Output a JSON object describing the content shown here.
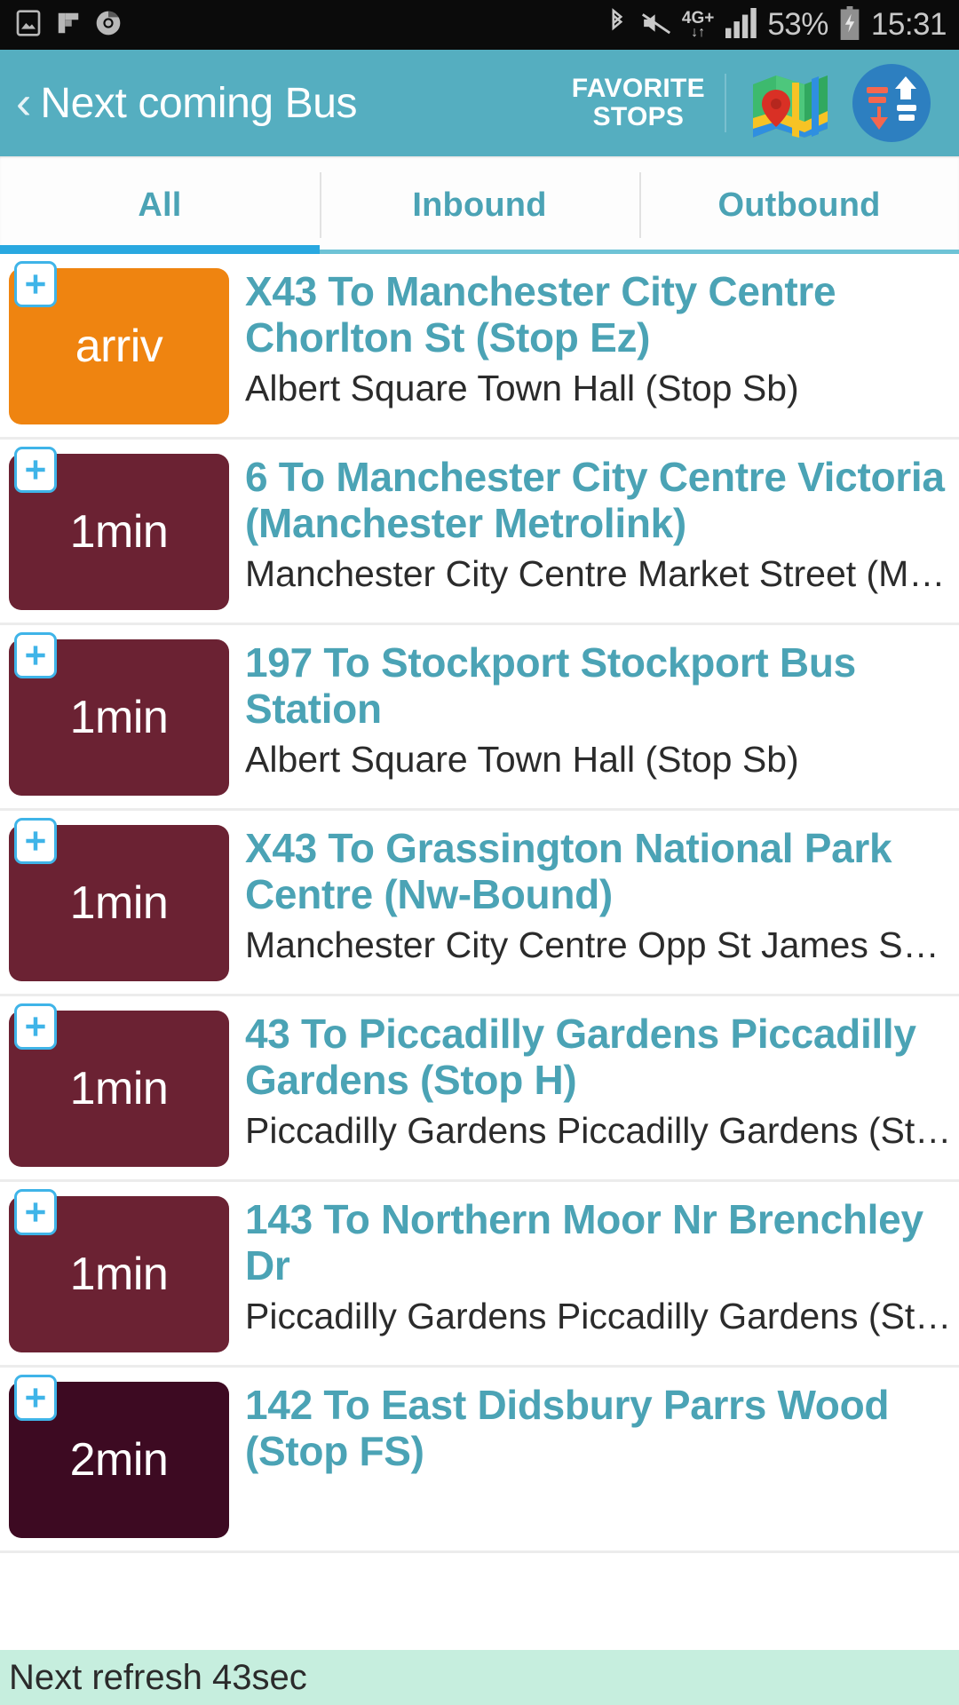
{
  "status_bar": {
    "time": "15:31",
    "battery_percent": "53%",
    "network": "4G+",
    "left_icons": [
      "gallery-icon",
      "flipboard-icon",
      "chrome-icon"
    ],
    "right_icons": [
      "bluetooth-icon",
      "mute-icon",
      "data-transfer-icon",
      "signal-bars-icon",
      "battery-charging-icon"
    ]
  },
  "app_bar": {
    "back_label": "‹",
    "title": "Next coming Bus",
    "favorite_stops_line1": "FAVORITE",
    "favorite_stops_line2": "STOPS",
    "map_icon": "map-icon",
    "sort_icon": "sort-refresh-icon",
    "background_color": "#55aec0"
  },
  "tabs": {
    "active_index": 0,
    "items": [
      {
        "label": "All"
      },
      {
        "label": "Inbound"
      },
      {
        "label": "Outbound"
      }
    ],
    "active_color": "#29a8e0",
    "text_color": "#4ba3b5"
  },
  "list": {
    "rows": [
      {
        "time": "arriv",
        "badge_color": "#ef8410",
        "route": "X43 To Manchester City Centre Chorlton St (Stop Ez)",
        "stop": "Albert Square Town Hall (Stop Sb)",
        "add_icon": "plus-icon"
      },
      {
        "time": "1min",
        "badge_color": "#6b2233",
        "route": "6 To Manchester City Centre Victoria (Manchester Metrolink)",
        "stop": "Manchester City Centre Market Street (M…",
        "add_icon": "plus-icon"
      },
      {
        "time": "1min",
        "badge_color": "#6b2233",
        "route": "197 To Stockport Stockport Bus Station",
        "stop": "Albert Square Town Hall (Stop Sb)",
        "add_icon": "plus-icon"
      },
      {
        "time": "1min",
        "badge_color": "#6b2233",
        "route": "X43 To Grassington National Park Centre (Nw-Bound)",
        "stop": "Manchester City Centre Opp St James Sq…",
        "add_icon": "plus-icon"
      },
      {
        "time": "1min",
        "badge_color": "#6b2233",
        "route": "43 To Piccadilly Gardens Piccadilly Gardens (Stop H)",
        "stop": "Piccadilly Gardens Piccadilly Gardens (St…",
        "add_icon": "plus-icon"
      },
      {
        "time": "1min",
        "badge_color": "#6b2233",
        "route": "143 To Northern Moor Nr Brenchley Dr",
        "stop": "Piccadilly Gardens Piccadilly Gardens (St…",
        "add_icon": "plus-icon"
      },
      {
        "time": "2min",
        "badge_color": "#3d0a22",
        "route": "142 To East Didsbury Parrs Wood (Stop FS)",
        "stop": "",
        "add_icon": "plus-icon"
      }
    ]
  },
  "refresh_bar": {
    "text": "Next refresh 43sec",
    "background_color": "#c6eede"
  }
}
